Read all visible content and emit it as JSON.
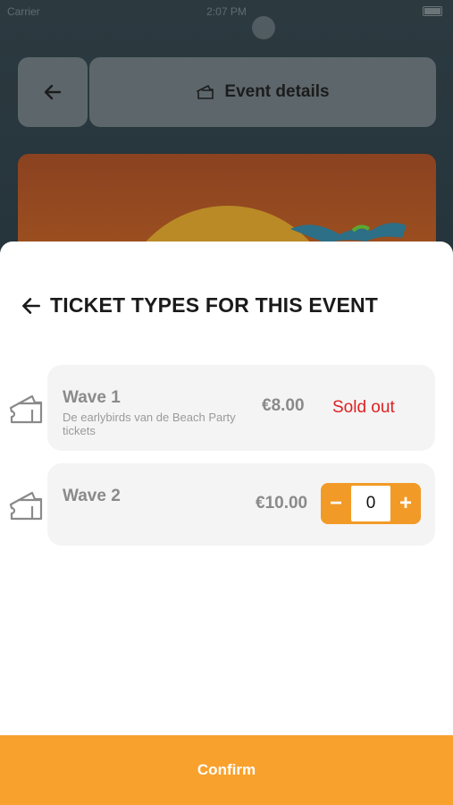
{
  "status_bar": {
    "carrier": "Carrier",
    "time": "2:07 PM"
  },
  "header": {
    "title": "Event details",
    "icons": {
      "back": "arrow-left-icon",
      "ticket": "ticket-icon"
    }
  },
  "sheet": {
    "title": "TICKET TYPES FOR THIS EVENT",
    "tickets": [
      {
        "name": "Wave 1",
        "description": "De earlybirds van de Beach Party tickets",
        "price": "€8.00",
        "status": "Sold out"
      },
      {
        "name": "Wave 2",
        "description": "",
        "price": "€10.00",
        "quantity": "0",
        "minus": "−",
        "plus": "+"
      }
    ]
  },
  "confirm_label": "Confirm",
  "colors": {
    "accent": "#f9a12d",
    "sold_out": "#e02020",
    "card_bg": "#f4f4f4"
  }
}
